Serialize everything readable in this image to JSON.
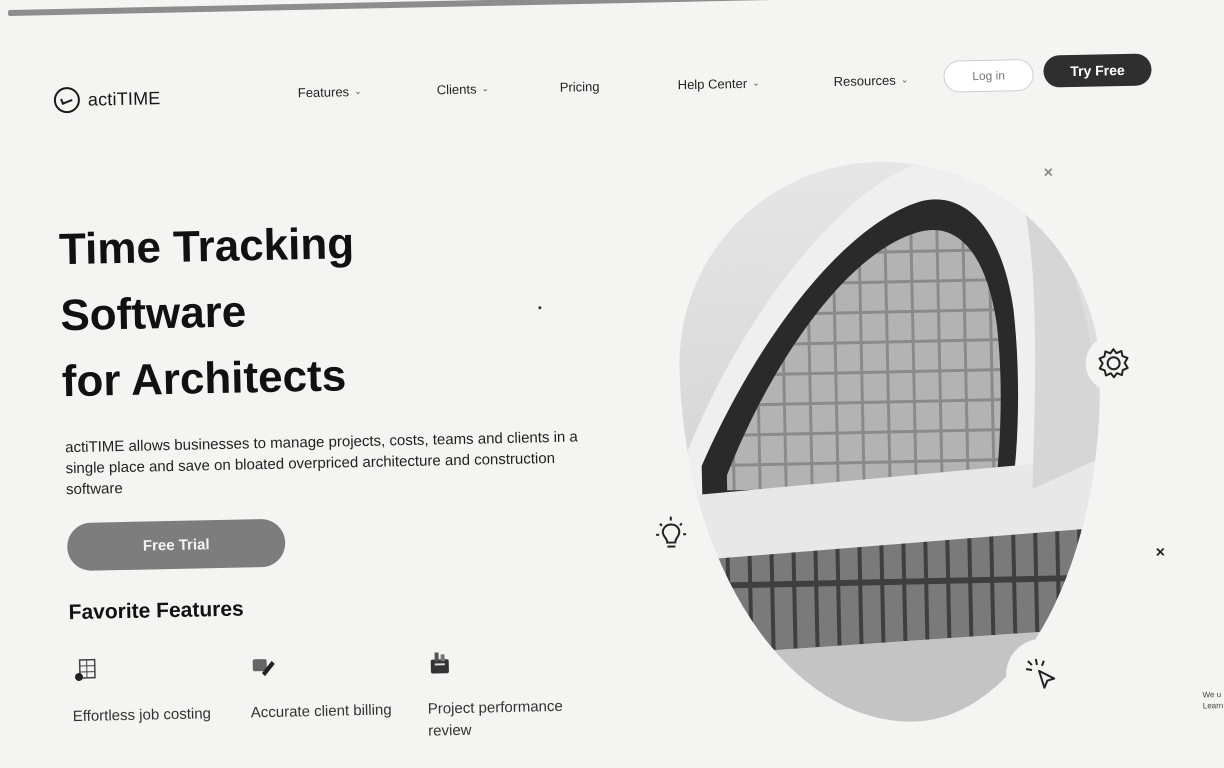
{
  "header": {
    "logo_text": "actiTIME",
    "nav": [
      {
        "label": "Features",
        "has_dropdown": true
      },
      {
        "label": "Clients",
        "has_dropdown": true
      },
      {
        "label": "Pricing",
        "has_dropdown": false
      },
      {
        "label": "Help Center",
        "has_dropdown": true
      },
      {
        "label": "Resources",
        "has_dropdown": true
      }
    ],
    "dropdown_glyph": "⌄",
    "login_label": "Log in",
    "try_free_label": "Try Free"
  },
  "hero": {
    "title_lines": [
      "Time Tracking",
      "Software",
      "for Architects"
    ],
    "description": "actiTIME allows businesses to manage projects, costs, teams and clients in a single place and save on bloated overpriced architecture and construction software",
    "cta_label": "Free Trial"
  },
  "features": {
    "title": "Favorite Features",
    "items": [
      {
        "label": "Effortless job costing",
        "icon": "spreadsheet-icon"
      },
      {
        "label": "Accurate client billing",
        "icon": "billing-icon"
      },
      {
        "label": "Project performance review",
        "icon": "performance-icon"
      }
    ]
  },
  "decorations": {
    "gear_icon": "gear-icon",
    "lightbulb_icon": "lightbulb-icon",
    "cursor_click_icon": "cursor-click-icon",
    "close_glyph": "×"
  },
  "side_text": "We u Learn",
  "colors": {
    "primary_dark": "#2f2f2f",
    "cta_gray": "#7d7d7d",
    "background": "#f4f4f2"
  }
}
